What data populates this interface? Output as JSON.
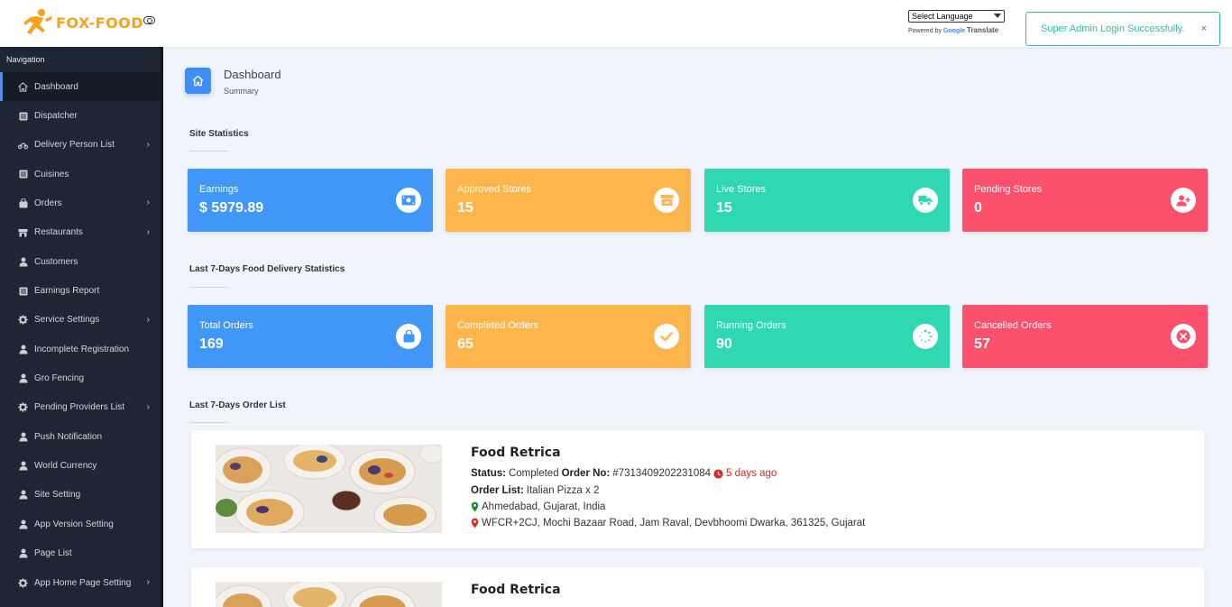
{
  "brand": {
    "name": "FOX-FOOD"
  },
  "language": {
    "select_label": "Select Language",
    "powered_by": "Powered by",
    "google": "Google",
    "translate": "Translate"
  },
  "toast": {
    "message": "Super Admin Login Successfully.",
    "close": "×"
  },
  "sidebar": {
    "title": "Navigation",
    "items": [
      {
        "label": "Dashboard",
        "icon": "home-icon",
        "active": true,
        "chevron": false
      },
      {
        "label": "Dispatcher",
        "icon": "list-icon",
        "chevron": false
      },
      {
        "label": "Delivery Person List",
        "icon": "motorcycle-icon",
        "chevron": true
      },
      {
        "label": "Cuisines",
        "icon": "list-icon",
        "chevron": false
      },
      {
        "label": "Orders",
        "icon": "shopping-bag-icon",
        "chevron": true
      },
      {
        "label": "Restaurants",
        "icon": "store-icon",
        "chevron": true
      },
      {
        "label": "Customers",
        "icon": "user-icon",
        "chevron": false
      },
      {
        "label": "Earnings Report",
        "icon": "list-icon",
        "chevron": false
      },
      {
        "label": "Service Settings",
        "icon": "gear-icon",
        "chevron": true
      },
      {
        "label": "Incomplete Registration",
        "icon": "user-icon",
        "chevron": false
      },
      {
        "label": "Gro Fencing",
        "icon": "user-icon",
        "chevron": false
      },
      {
        "label": "Pending Providers List",
        "icon": "gear-icon",
        "chevron": true
      },
      {
        "label": "Push Notification",
        "icon": "user-icon",
        "chevron": false
      },
      {
        "label": "World Currency",
        "icon": "user-icon",
        "chevron": false
      },
      {
        "label": "Site Setting",
        "icon": "user-icon",
        "chevron": false
      },
      {
        "label": "App Version Setting",
        "icon": "user-icon",
        "chevron": false
      },
      {
        "label": "Page List",
        "icon": "user-icon",
        "chevron": false
      },
      {
        "label": "App Home Page Setting",
        "icon": "gear-icon",
        "chevron": true
      }
    ]
  },
  "page": {
    "title": "Dashboard",
    "subtitle": "Summary"
  },
  "site_statistics": {
    "title": "Site Statistics",
    "cards": [
      {
        "label": "Earnings",
        "value": "$ 5979.89",
        "color": "#4097f8",
        "icon": "money-icon"
      },
      {
        "label": "Approved Stores",
        "value": "15",
        "color": "#fdb54c",
        "icon": "store-icon"
      },
      {
        "label": "Live Stores",
        "value": "15",
        "color": "#2fd7b2",
        "icon": "truck-icon"
      },
      {
        "label": "Pending Stores",
        "value": "0",
        "color": "#fb516c",
        "icon": "user-plus-icon"
      }
    ]
  },
  "delivery_statistics": {
    "title": "Last 7-Days Food Delivery Statistics",
    "cards": [
      {
        "label": "Total Orders",
        "value": "169",
        "color": "#4097f8",
        "icon": "shopping-bag-icon"
      },
      {
        "label": "Completed Orders",
        "value": "65",
        "color": "#fdb54c",
        "icon": "check-icon"
      },
      {
        "label": "Running Orders",
        "value": "90",
        "color": "#2fd7b2",
        "icon": "spinner-icon"
      },
      {
        "label": "Cancelled Orders",
        "value": "57",
        "color": "#fb516c",
        "icon": "times-icon"
      }
    ]
  },
  "order_list": {
    "title": "Last 7-Days Order List",
    "orders": [
      {
        "restaurant": "Food Retrica",
        "status_label": "Status:",
        "status": "Completed",
        "order_no_label": "Order No:",
        "order_no": "#7313409202231084",
        "time_ago": "5 days ago",
        "order_list_label": "Order List:",
        "items": "Italian Pizza x 2",
        "location": "Ahmedabad, Gujarat, India",
        "address": "WFCR+2CJ, Mochi Bazaar Road, Jam Raval, Devbhoomi Dwarka, 361325, Gujarat"
      },
      {
        "restaurant": "Food Retrica"
      }
    ]
  }
}
